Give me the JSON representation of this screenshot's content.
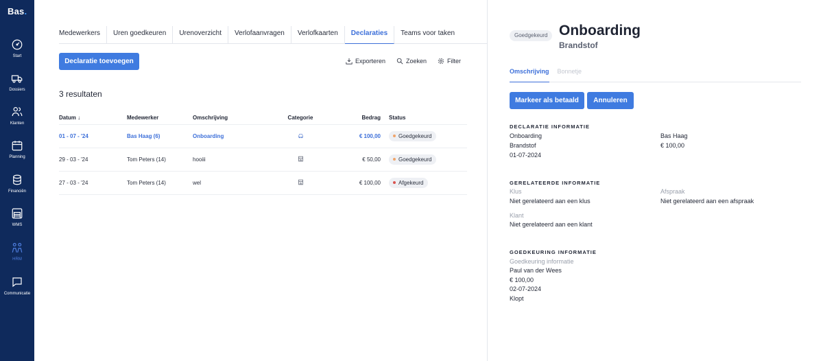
{
  "sidebar": {
    "brand": "Bas",
    "items": [
      {
        "label": "Start",
        "icon": "dashboard-gauge-icon"
      },
      {
        "label": "Dossiers",
        "icon": "truck-icon"
      },
      {
        "label": "Klanten",
        "icon": "customers-icon"
      },
      {
        "label": "Planning",
        "icon": "calendar-icon"
      },
      {
        "label": "Financiën",
        "icon": "coins-icon"
      },
      {
        "label": "WMS",
        "icon": "warehouse-icon"
      },
      {
        "label": "HRM",
        "icon": "people-icon",
        "active": true
      },
      {
        "label": "Communicatie",
        "icon": "chat-icon"
      }
    ]
  },
  "tabs": [
    "Medewerkers",
    "Uren goedkeuren",
    "Urenoverzicht",
    "Verlofaanvragen",
    "Verlofkaarten",
    "Declaraties",
    "Teams voor taken"
  ],
  "active_tab": "Declaraties",
  "add_button": "Declaratie toevoegen",
  "toolbar": {
    "export": "Exporteren",
    "search": "Zoeken",
    "filter": "Filter"
  },
  "results": "3 resultaten",
  "table": {
    "headers": {
      "date": "Datum",
      "employee": "Medewerker",
      "description": "Omschrijving",
      "category": "Categorie",
      "amount": "Bedrag",
      "status": "Status"
    },
    "rows": [
      {
        "date": "01 - 07 - '24",
        "employee": "Bas Haag (6)",
        "description": "Onboarding",
        "category": "car-icon",
        "amount": "€ 100,00",
        "status": "Goedgekeurd",
        "status_color": "#f0a46a",
        "highlight": true
      },
      {
        "date": "29 - 03 - '24",
        "employee": "Tom Peters (14)",
        "description": "hooiii",
        "category": "building-icon",
        "amount": "€ 50,00",
        "status": "Goedgekeurd",
        "status_color": "#f0a46a",
        "highlight": false
      },
      {
        "date": "27 - 03 - '24",
        "employee": "Tom Peters (14)",
        "description": "wel",
        "category": "building-icon",
        "amount": "€ 100,00",
        "status": "Afgekeurd",
        "status_color": "#d9534f",
        "highlight": false
      }
    ]
  },
  "detail": {
    "badge": "Goedgekeurd",
    "title": "Onboarding",
    "subtitle": "Brandstof",
    "tabs": {
      "description": "Omschrijving",
      "receipt": "Bonnetje"
    },
    "mark_paid": "Markeer als betaald",
    "cancel": "Annuleren",
    "declaration": {
      "heading": "DECLARATIE INFORMATIE",
      "description": "Onboarding",
      "category": "Brandstof",
      "date": "01-07-2024",
      "employee": "Bas Haag",
      "amount": "€ 100,00"
    },
    "related": {
      "heading": "GERELATEERDE INFORMATIE",
      "job_label": "Klus",
      "job_value": "Niet gerelateerd aan een klus",
      "appointment_label": "Afspraak",
      "appointment_value": "Niet gerelateerd aan een afspraak",
      "customer_label": "Klant",
      "customer_value": "Niet gerelateerd aan een klant"
    },
    "approval": {
      "heading": "GOEDKEURING INFORMATIE",
      "label": "Goedkeuring informatie",
      "approver": "Paul van der Wees",
      "amount": "€ 100,00",
      "date": "02-07-2024",
      "note": "Klopt"
    }
  },
  "colors": {
    "sidebar": "#0f2a5c",
    "accent": "#3f7be0",
    "approved": "#f0a46a",
    "rejected": "#d9534f"
  }
}
